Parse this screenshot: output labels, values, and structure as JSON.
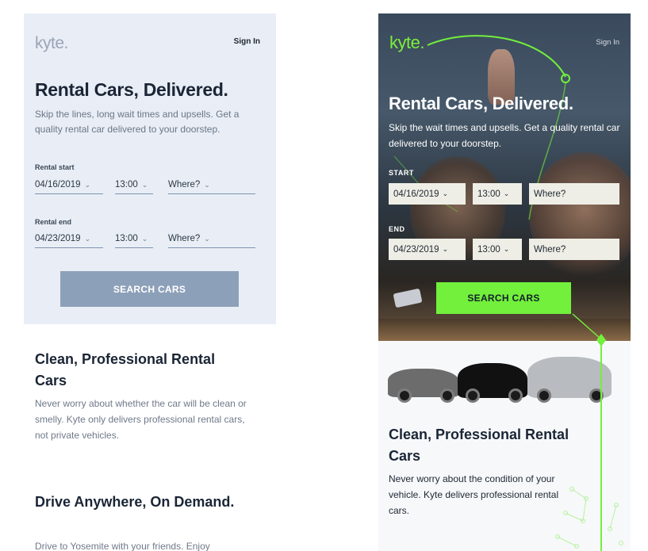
{
  "left": {
    "logo": "kyte.",
    "sign_in": "Sign In",
    "headline": "Rental Cars, Delivered.",
    "subtitle": "Skip the lines, long wait times and upsells. Get a quality rental car delivered to your doorstep.",
    "rental_start_label": "Rental start",
    "rental_end_label": "Rental end",
    "start_date": "04/16/2019",
    "start_time": "13:00",
    "start_where": "Where?",
    "end_date": "04/23/2019",
    "end_time": "13:00",
    "end_where": "Where?",
    "search_button": "SEARCH CARS",
    "section1_title": "Clean, Professional Rental Cars",
    "section1_text": "Never worry about whether the car will be clean or smelly. Kyte only delivers professional rental cars, not private vehicles.",
    "section2_title": "Drive Anywhere, On Demand.",
    "section2_text": "Drive to Yosemite with your friends. Enjoy"
  },
  "right": {
    "logo": "kyte.",
    "sign_in": "Sign In",
    "headline": "Rental Cars, Delivered.",
    "subtitle": "Skip the wait times and upsells. Get a quality rental car delivered to your doorstep.",
    "start_label": "START",
    "end_label": "END",
    "start_date": "04/16/2019",
    "start_time": "13:00",
    "start_where": "Where?",
    "end_date": "04/23/2019",
    "end_time": "13:00",
    "end_where": "Where?",
    "search_button": "SEARCH CARS",
    "section1_title": "Clean, Professional Rental Cars",
    "section1_text": "Never worry about the condition of your vehicle. Kyte delivers professional rental cars."
  },
  "icons": {
    "dropdown": "chevron-down-icon"
  },
  "colors": {
    "brand_green": "#72f03c",
    "left_button": "#8da0b9",
    "heading_dark": "#1a2535"
  }
}
